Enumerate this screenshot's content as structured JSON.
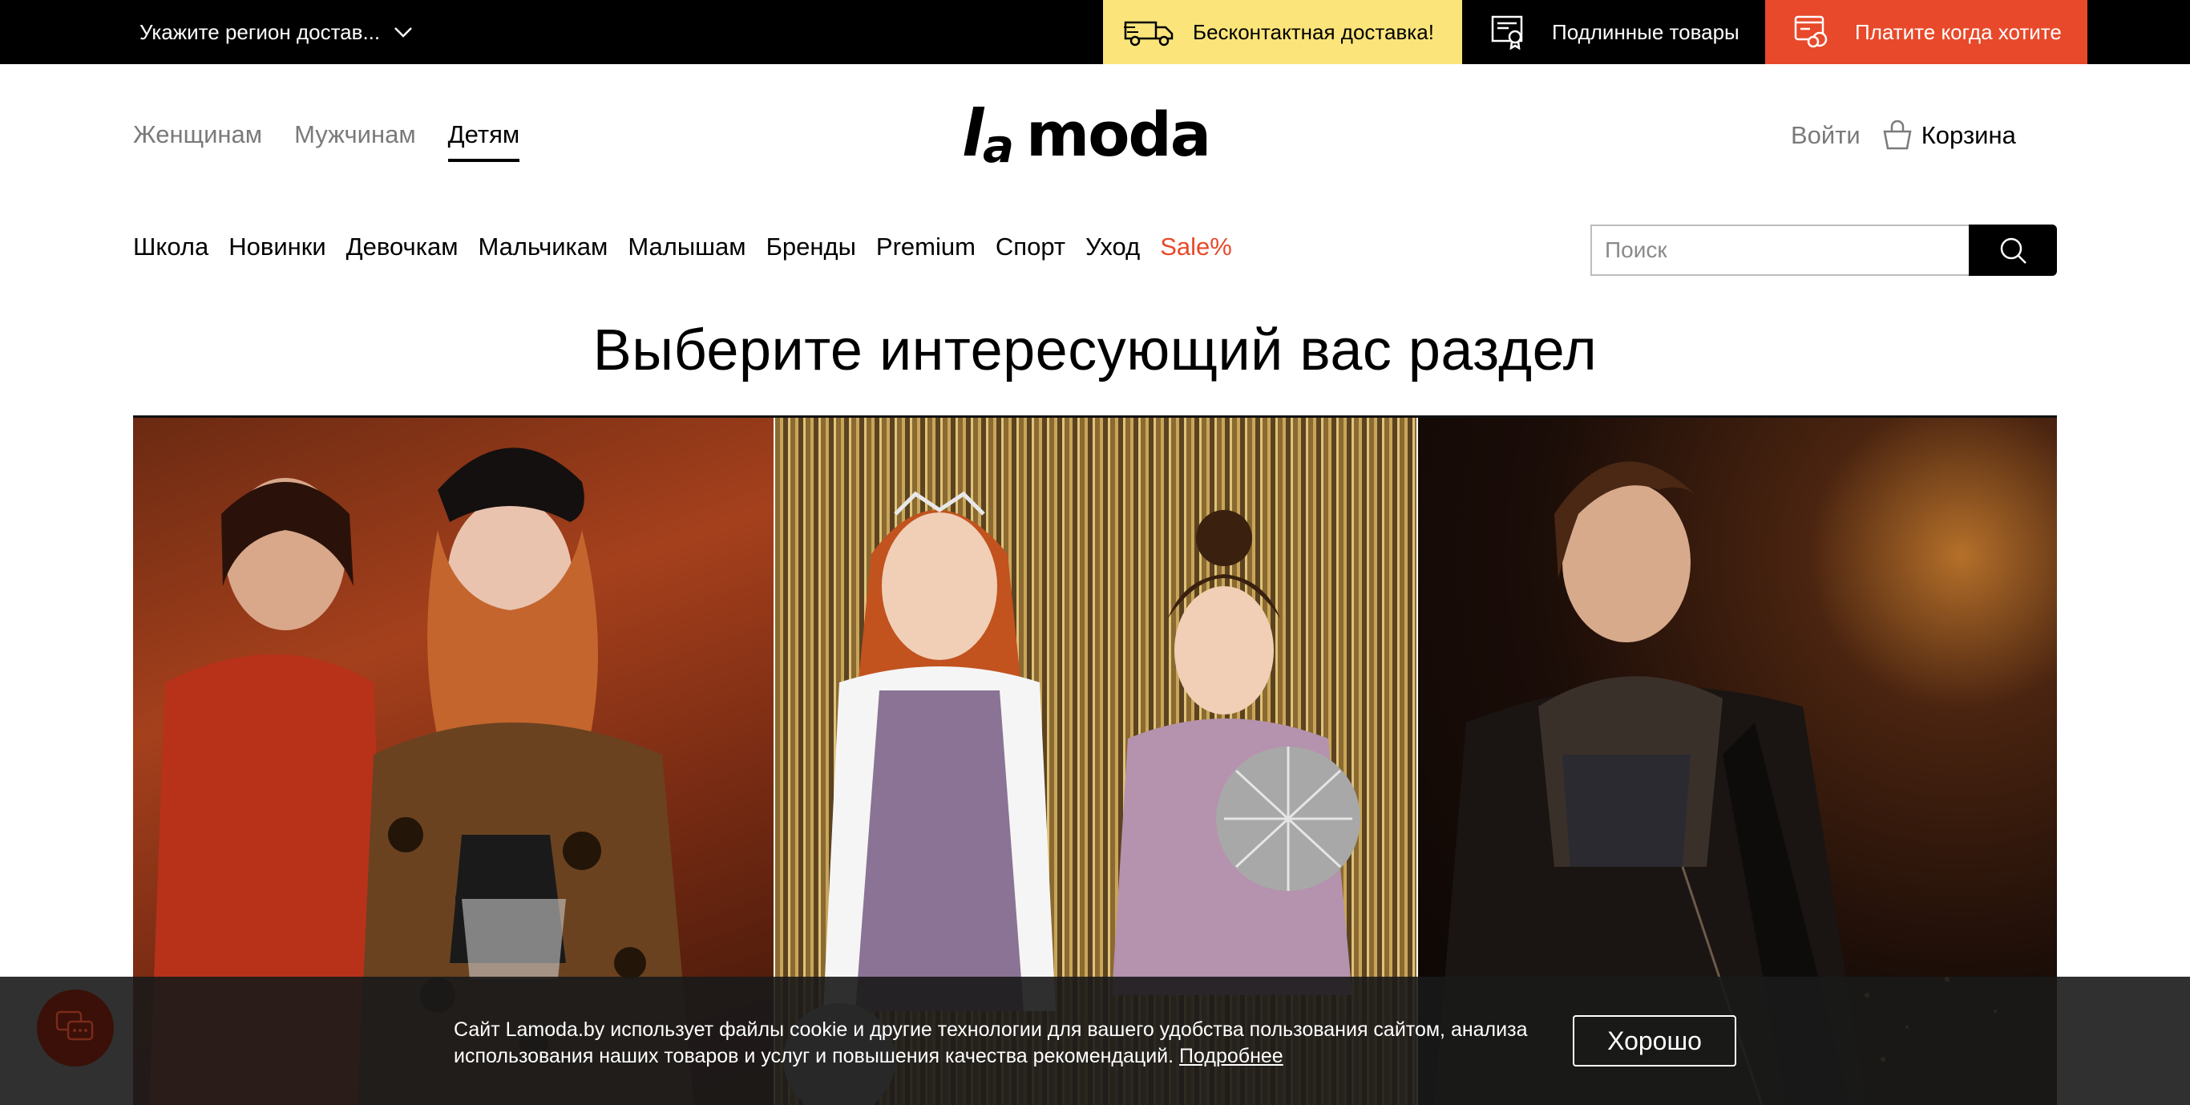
{
  "topbar": {
    "region_label": "Укажите регион достав...",
    "promos": {
      "delivery": "Бесконтактная доставка!",
      "genuine": "Подлинные товары",
      "pay": "Платите когда хотите"
    }
  },
  "header": {
    "gender_tabs": [
      "Женщинам",
      "Мужчинам",
      "Детям"
    ],
    "active_gender": "Детям",
    "logo": "lamoda",
    "login": "Войти",
    "cart": "Корзина"
  },
  "categories": [
    "Школа",
    "Новинки",
    "Девочкам",
    "Мальчикам",
    "Малышам",
    "Бренды",
    "Premium",
    "Спорт",
    "Уход",
    "Sale%"
  ],
  "search": {
    "placeholder": "Поиск"
  },
  "main": {
    "title": "Выберите интересующий вас раздел"
  },
  "cookie": {
    "text": "Сайт Lamoda.by использует файлы cookie и другие технологии для вашего удобства пользования сайтом, анализа использования наших товаров и услуг и повышения качества рекомендаций.",
    "more_link": "Подробнее",
    "ok_button": "Хорошо"
  },
  "colors": {
    "accent_sale": "#e8492a",
    "promo_yellow": "#fbe57a",
    "promo_orange": "#e8492a"
  },
  "icons": [
    "chevron-down-icon",
    "truck-icon",
    "certificate-icon",
    "card-icon",
    "cart-icon",
    "search-icon",
    "chat-icon"
  ]
}
